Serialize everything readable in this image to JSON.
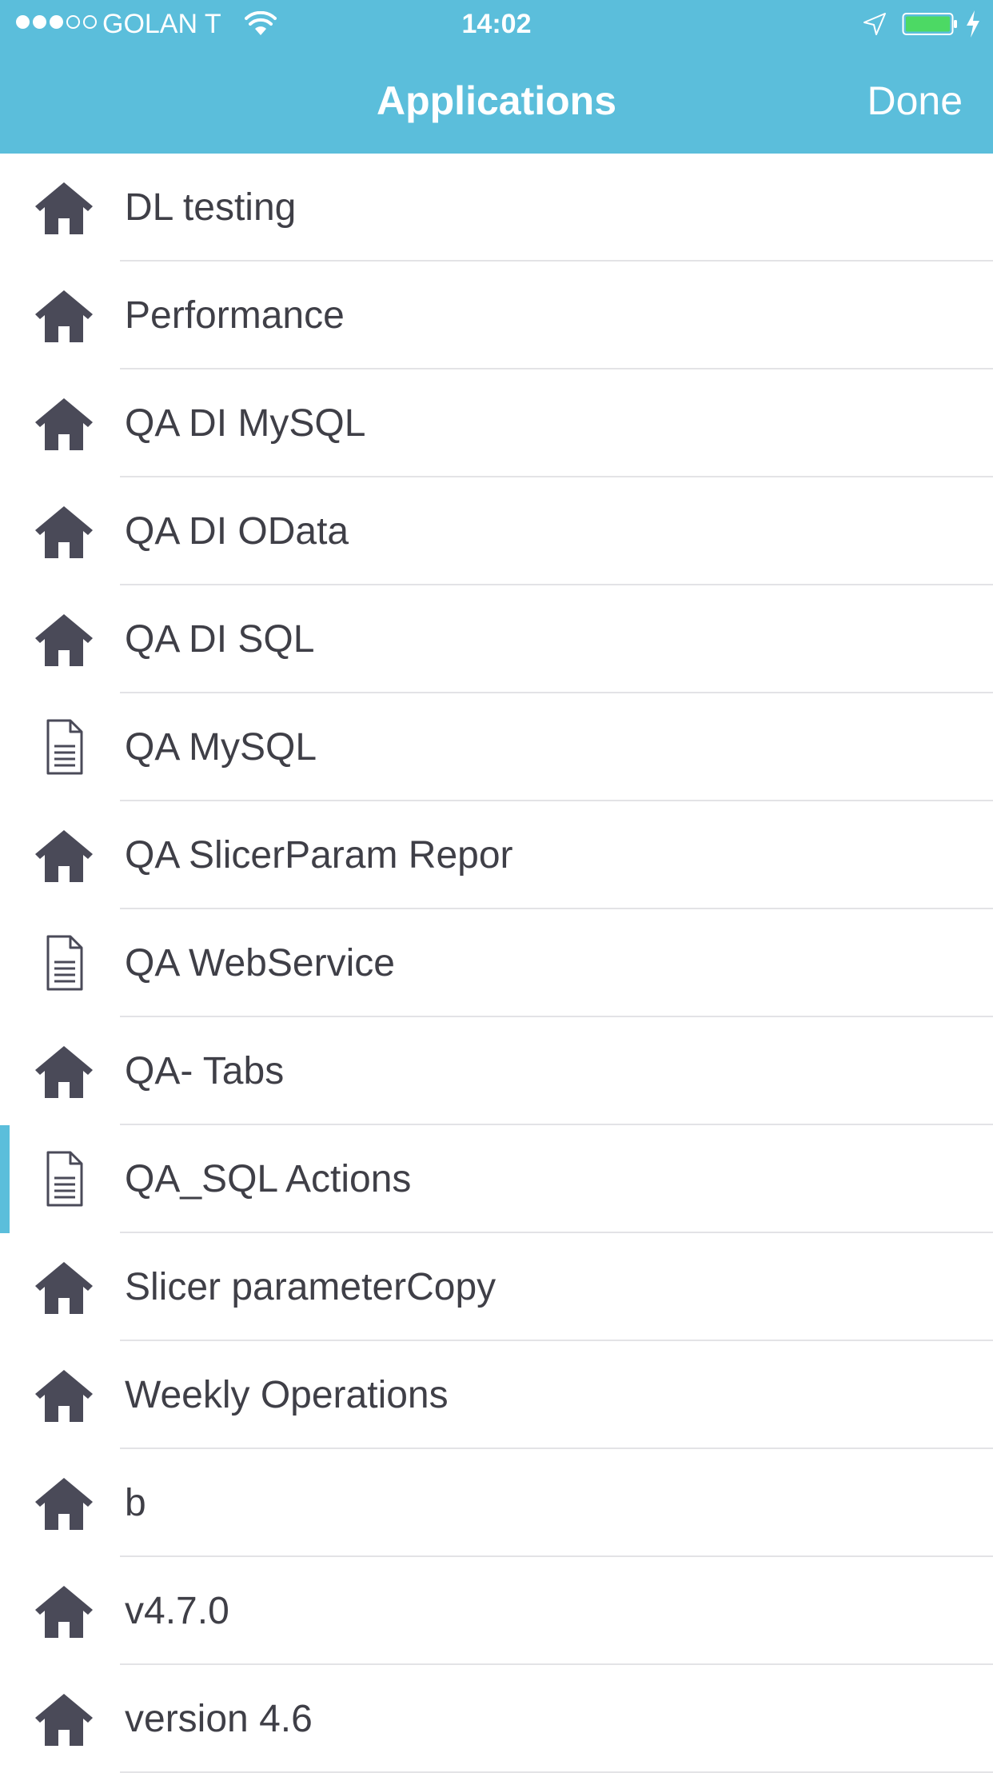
{
  "status_bar": {
    "carrier": "GOLAN T",
    "time": "14:02",
    "signal_bars_filled": 3,
    "signal_bars_total": 5,
    "battery_color": "#4cd964"
  },
  "nav": {
    "title": "Applications",
    "done_label": "Done",
    "bar_color": "#5bbedb"
  },
  "applications": [
    {
      "label": "DL testing",
      "icon": "home-icon"
    },
    {
      "label": "Performance",
      "icon": "home-icon"
    },
    {
      "label": "QA DI MySQL",
      "icon": "home-icon"
    },
    {
      "label": "QA DI OData",
      "icon": "home-icon"
    },
    {
      "label": "QA DI SQL",
      "icon": "home-icon"
    },
    {
      "label": "QA MySQL",
      "icon": "document-icon"
    },
    {
      "label": "QA SlicerParam Repor",
      "icon": "home-icon"
    },
    {
      "label": "QA WebService",
      "icon": "document-icon"
    },
    {
      "label": "QA- Tabs",
      "icon": "home-icon"
    },
    {
      "label": "QA_SQL Actions",
      "icon": "document-icon",
      "selected": true
    },
    {
      "label": "Slicer parameterCopy",
      "icon": "home-icon"
    },
    {
      "label": "Weekly Operations",
      "icon": "home-icon"
    },
    {
      "label": "b",
      "icon": "home-icon"
    },
    {
      "label": "v4.7.0",
      "icon": "home-icon"
    },
    {
      "label": "version 4.6",
      "icon": "home-icon"
    }
  ]
}
